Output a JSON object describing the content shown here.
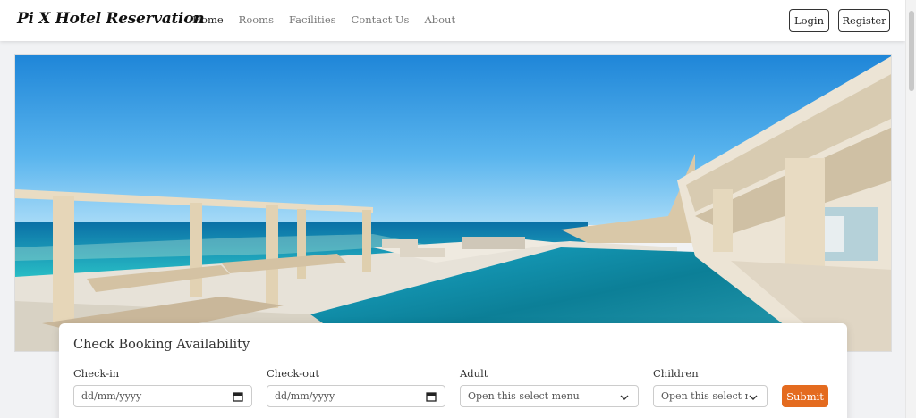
{
  "brand": "Pi X Hotel Reservation",
  "nav": {
    "items": [
      {
        "label": "Home",
        "active": true
      },
      {
        "label": "Rooms",
        "active": false
      },
      {
        "label": "Facilities",
        "active": false
      },
      {
        "label": "Contact Us",
        "active": false
      },
      {
        "label": "About",
        "active": false
      }
    ],
    "login": "Login",
    "register": "Register"
  },
  "hero": {
    "image": "infinity pool overlooking the sea"
  },
  "booking": {
    "title": "Check Booking Availability",
    "checkin": {
      "label": "Check-in",
      "placeholder": "dd/mm/yyyy"
    },
    "checkout": {
      "label": "Check-out",
      "placeholder": "dd/mm/yyyy"
    },
    "adult": {
      "label": "Adult",
      "selected": "Open this select menu"
    },
    "children": {
      "label": "Children",
      "selected": "Open this select me"
    },
    "submit": "Submit"
  },
  "colors": {
    "accent": "#e46b1f",
    "navbar": "#ffffff",
    "background": "#f1f2f4"
  }
}
